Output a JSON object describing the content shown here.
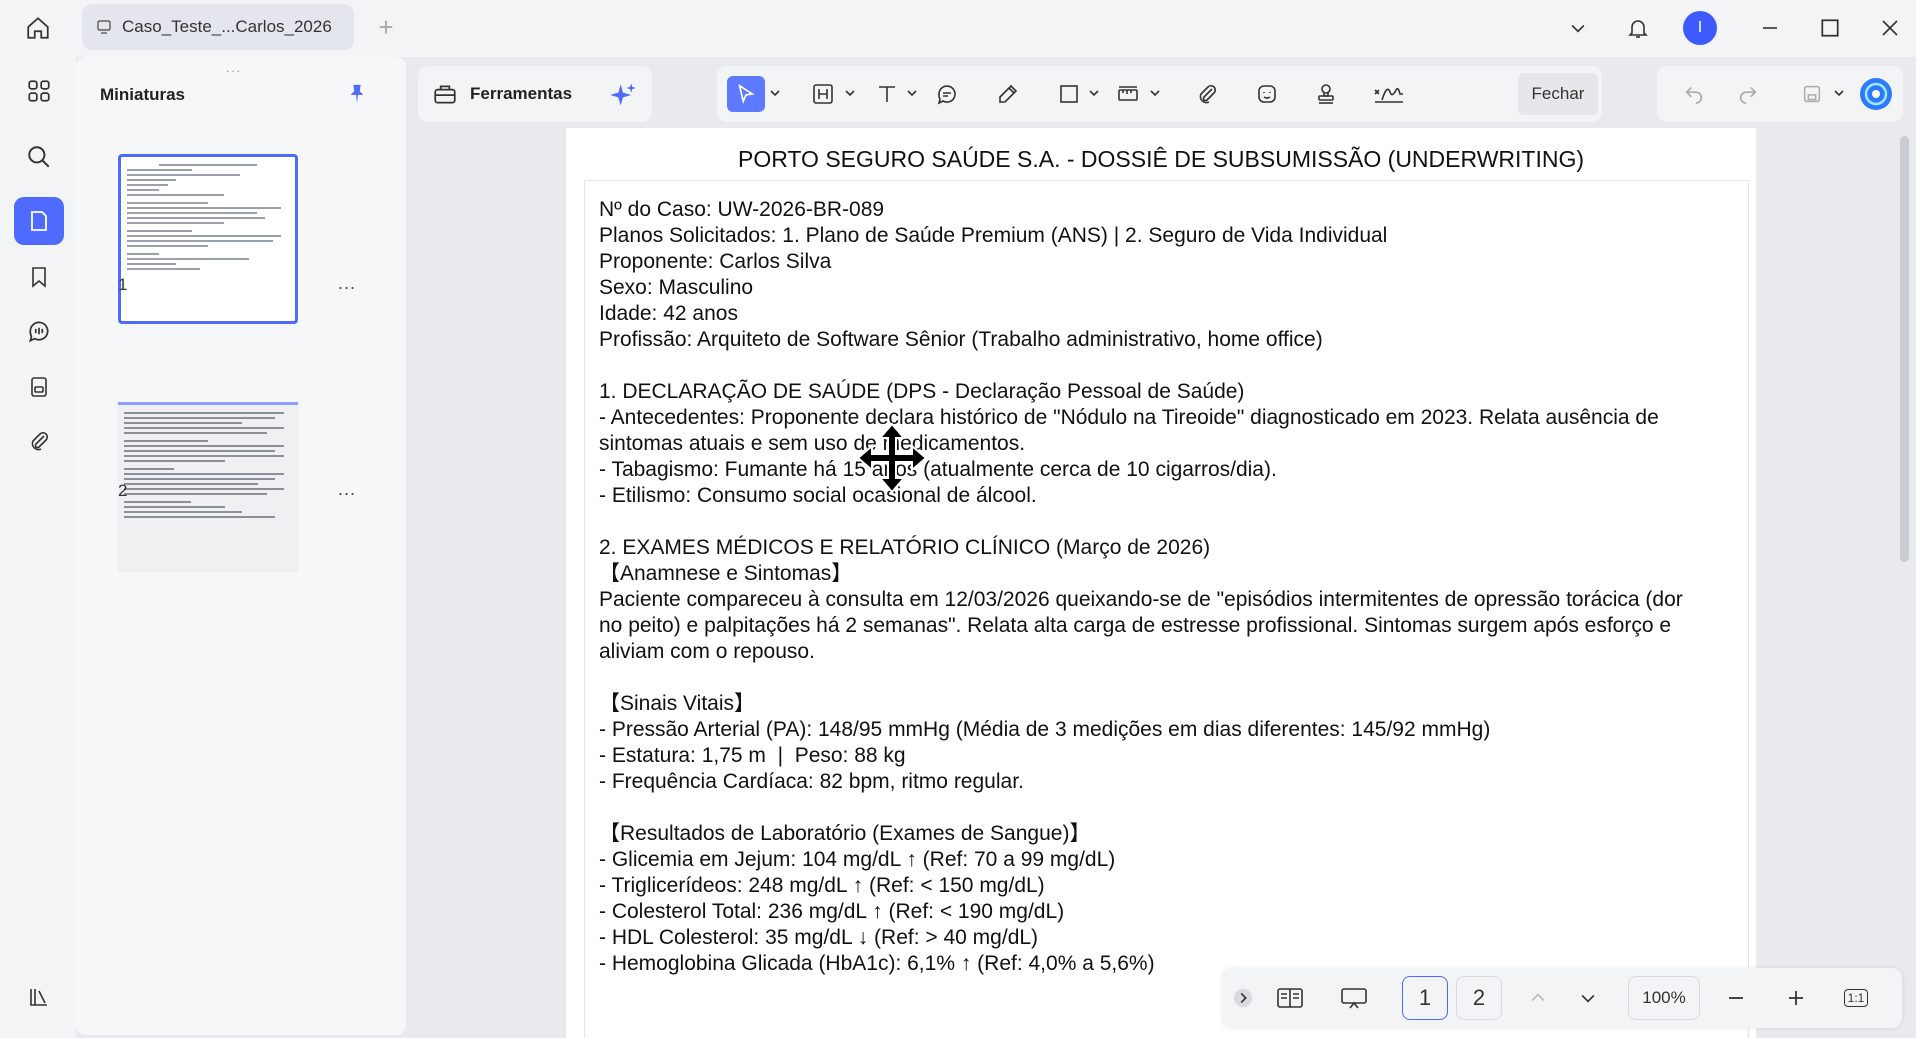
{
  "titlebar": {
    "tab_title": "Caso_Teste_...Carlos_2026",
    "avatar_letter": "I"
  },
  "thumbnails": {
    "title": "Miniaturas",
    "handle": "...",
    "pages": [
      {
        "number": "1",
        "more": "..."
      },
      {
        "number": "2",
        "more": "..."
      }
    ]
  },
  "toolbar": {
    "tools_label": "Ferramentas",
    "close_label": "Fechar",
    "accent_color": "#4f6bff"
  },
  "document": {
    "title": "PORTO SEGURO SAÚDE S.A. - DOSSIÊ DE SUBSUMISSÃO (UNDERWRITING)",
    "lines": [
      "Nº do Caso: UW-2026-BR-089",
      "Planos Solicitados: 1. Plano de Saúde Premium (ANS) | 2. Seguro de Vida Individual",
      "Proponente: Carlos Silva",
      "Sexo: Masculino",
      "Idade: 42 anos",
      "Profissão: Arquiteto de Software Sênior (Trabalho administrativo, home office)",
      "",
      "1. DECLARAÇÃO DE SAÚDE (DPS - Declaração Pessoal de Saúde)",
      "- Antecedentes: Proponente declara histórico de \"Nódulo na Tireoide\" diagnosticado em 2023. Relata ausência de",
      "sintomas atuais e sem uso de medicamentos.",
      "- Tabagismo: Fumante há 15 anos (atualmente cerca de 10 cigarros/dia).",
      "- Etilismo: Consumo social ocasional de álcool.",
      "",
      "2. EXAMES MÉDICOS E RELATÓRIO CLÍNICO (Março de 2026)",
      "【Anamnese e Sintomas】",
      "Paciente compareceu à consulta em 12/03/2026 queixando-se de \"episódios intermitentes de opressão torácica (dor",
      "no peito) e palpitações há 2 semanas\". Relata alta carga de estresse profissional. Sintomas surgem após esforço e",
      "aliviam com o repouso.",
      "",
      "【Sinais Vitais】",
      "- Pressão Arterial (PA): 148/95 mmHg (Média de 3 medições em dias diferentes: 145/92 mmHg)",
      "- Estatura: 1,75 m  |  Peso: 88 kg",
      "- Frequência Cardíaca: 82 bpm, ritmo regular.",
      "",
      "【Resultados de Laboratório (Exames de Sangue)】",
      "- Glicemia em Jejum: 104 mg/dL ↑ (Ref: 70 a 99 mg/dL)",
      "- Triglicerídeos: 248 mg/dL ↑ (Ref: < 150 mg/dL)",
      "- Colesterol Total: 236 mg/dL ↑ (Ref: < 190 mg/dL)",
      "- HDL Colesterol: 35 mg/dL ↓ (Ref: > 40 mg/dL)",
      "- Hemoglobina Glicada (HbA1c): 6,1% ↑ (Ref: 4,0% a 5,6%)"
    ]
  },
  "bottom_bar": {
    "pages": [
      "1",
      "2"
    ],
    "current_page": "1",
    "zoom": "100%",
    "actual_size": "1:1"
  }
}
